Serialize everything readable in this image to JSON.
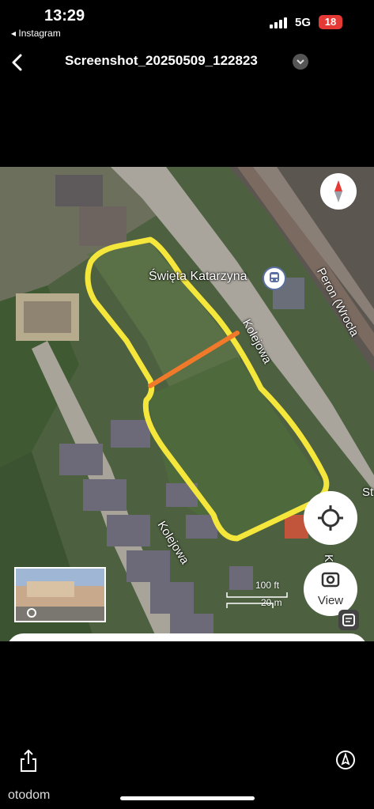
{
  "status": {
    "time": "13:29",
    "back_app": "◂ Instagram",
    "network": "5G",
    "battery": "18"
  },
  "header": {
    "title": "Screenshot_20250509_122823"
  },
  "map": {
    "place_label": "Święta Katarzyna",
    "street_kolejowa_top": "Kolejowa",
    "street_kolejowa_bottom": "Kolejowa",
    "peron_label": "Peron (Wrocła",
    "street_st": "St",
    "street_kc": "Kc",
    "scale_ft": "100 ft",
    "scale_m": "20 m",
    "view_button_label": "View",
    "colors": {
      "plot_outline": "#f5e63c",
      "divider_line": "#f07a2a"
    }
  },
  "footer": {
    "watermark": "otodom"
  }
}
